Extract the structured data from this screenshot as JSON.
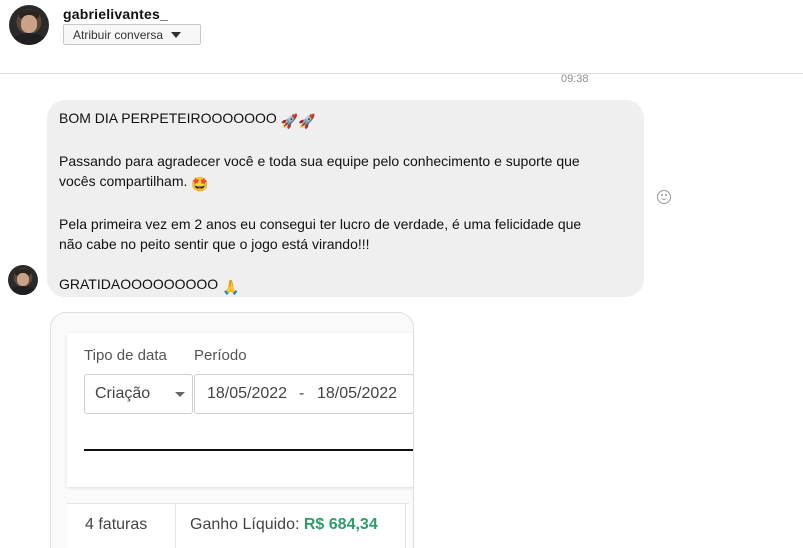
{
  "header": {
    "username": "gabrielivantes_",
    "assign_button": "Atribuir conversa"
  },
  "message": {
    "time": "09:38",
    "greeting": "BOM DIA PERPETEIROOOOOOO",
    "greeting_emoji": "🚀🚀",
    "thanks_line1": "Passando para agradecer você e toda sua equipe pelo conhecimento e suporte que",
    "thanks_line2": "vocês compartilham.",
    "thanks_emoji": "🤩",
    "profit_line1": "Pela primeira vez em 2 anos eu consegui ter lucro de verdade, é uma felicidade que",
    "profit_line2": "não cabe no peito sentir que o jogo está virando!!!",
    "gratitude": "GRATIDAOOOOOOOOO",
    "gratitude_emoji": "🙏"
  },
  "attachment": {
    "tipo_label": "Tipo de data",
    "periodo_label": "Período",
    "select_value": "Criação",
    "date_from": "18/05/2022",
    "date_separator": "-",
    "date_to": "18/05/2022",
    "invoice_count": "4 faturas",
    "net_gain_label": "Ganho Líquido:",
    "net_gain_value": "R$ 684,34"
  },
  "icons": {
    "reaction": "smiley-icon",
    "dropdown": "chevron-down-icon"
  },
  "colors": {
    "bubble": "#efefef",
    "gain_value": "#2e9c6a"
  }
}
